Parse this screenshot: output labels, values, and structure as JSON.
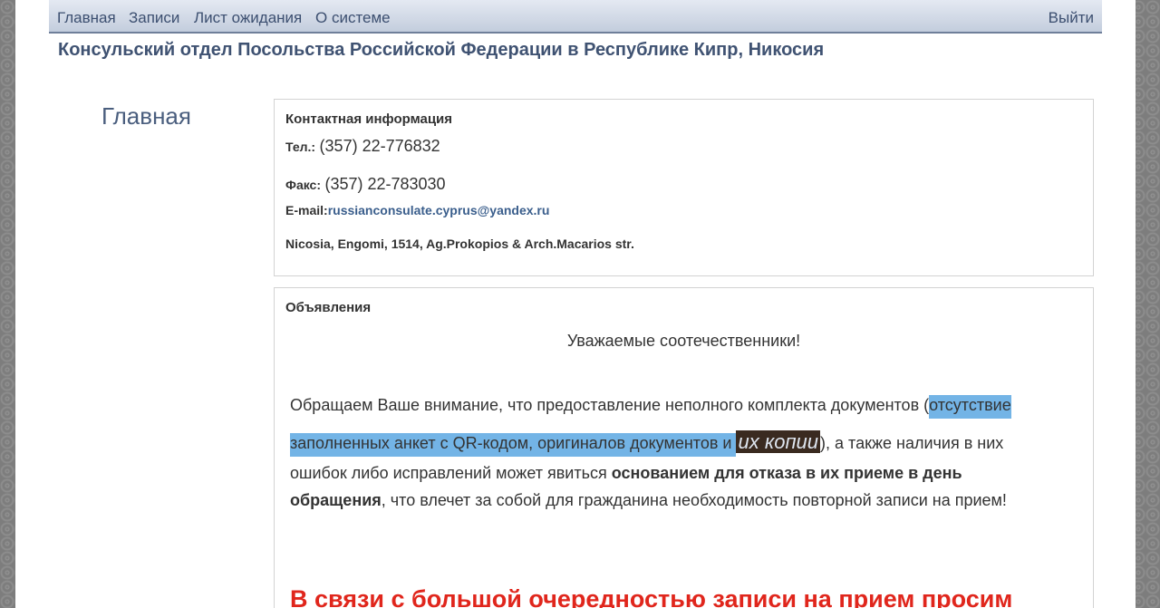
{
  "nav": {
    "home": "Главная",
    "records": "Записи",
    "waitlist": "Лист ожидания",
    "about": "О системе",
    "logout": "Выйти"
  },
  "site_title": "Консульский отдел Посольства Российской Федерации в Республике Кипр, Никосия",
  "page_title": "Главная",
  "contact": {
    "heading": "Контактная информация",
    "phone_label": "Тел.:",
    "phone": "(357) 22-776832",
    "fax_label": "Факс:",
    "fax": "(357) 22-783030",
    "email_label": "E-mail:",
    "email": "russianconsulate.cyprus@yandex.ru",
    "address": "Nicosia, Engomi, 1514, Ag.Prokopios & Arch.Macarios str."
  },
  "ads": {
    "heading": "Объявления",
    "greeting": "Уважаемые соотечественники!",
    "p1_part1": "Обращаем Ваше внимание, что предоставление неполного комплекта документов (",
    "p1_hl1": "отсутствие",
    "p1_hl2": "заполненных анкет с QR-кодом, оригиналов документов и ",
    "p1_hl3": "их копии",
    "p1_part2": "), а также наличия в них",
    "p1_part3": "ошибок либо исправлений может явиться ",
    "p1_bold1": "основанием для отказа в их приеме в день",
    "p1_bold2": "обращения",
    "p1_part4": ", что влечет за собой для гражданина необходимость повторной записи на прием!",
    "warning": "В связи с большой очередностью записи на прием просим"
  },
  "colors": {
    "navbar": "#c3cddd",
    "title": "#3f5272",
    "highlight": "#73b4e6",
    "warning": "#e0261c"
  }
}
